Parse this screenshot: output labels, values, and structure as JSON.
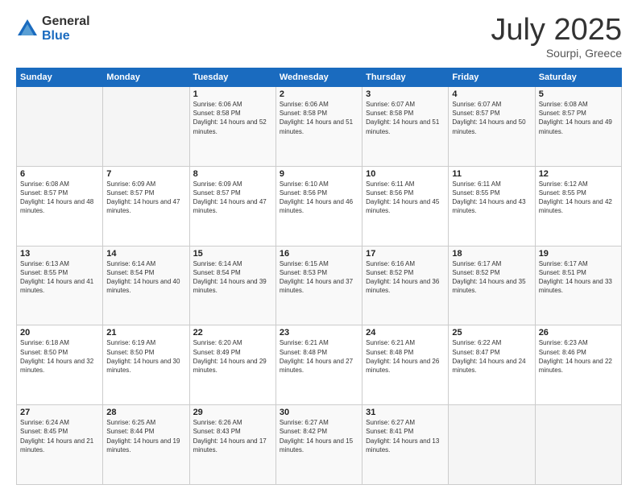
{
  "header": {
    "logo_general": "General",
    "logo_blue": "Blue",
    "month_title": "July 2025",
    "location": "Sourpi, Greece"
  },
  "weekdays": [
    "Sunday",
    "Monday",
    "Tuesday",
    "Wednesday",
    "Thursday",
    "Friday",
    "Saturday"
  ],
  "weeks": [
    [
      {
        "day": "",
        "sunrise": "",
        "sunset": "",
        "daylight": ""
      },
      {
        "day": "",
        "sunrise": "",
        "sunset": "",
        "daylight": ""
      },
      {
        "day": "1",
        "sunrise": "Sunrise: 6:06 AM",
        "sunset": "Sunset: 8:58 PM",
        "daylight": "Daylight: 14 hours and 52 minutes."
      },
      {
        "day": "2",
        "sunrise": "Sunrise: 6:06 AM",
        "sunset": "Sunset: 8:58 PM",
        "daylight": "Daylight: 14 hours and 51 minutes."
      },
      {
        "day": "3",
        "sunrise": "Sunrise: 6:07 AM",
        "sunset": "Sunset: 8:58 PM",
        "daylight": "Daylight: 14 hours and 51 minutes."
      },
      {
        "day": "4",
        "sunrise": "Sunrise: 6:07 AM",
        "sunset": "Sunset: 8:57 PM",
        "daylight": "Daylight: 14 hours and 50 minutes."
      },
      {
        "day": "5",
        "sunrise": "Sunrise: 6:08 AM",
        "sunset": "Sunset: 8:57 PM",
        "daylight": "Daylight: 14 hours and 49 minutes."
      }
    ],
    [
      {
        "day": "6",
        "sunrise": "Sunrise: 6:08 AM",
        "sunset": "Sunset: 8:57 PM",
        "daylight": "Daylight: 14 hours and 48 minutes."
      },
      {
        "day": "7",
        "sunrise": "Sunrise: 6:09 AM",
        "sunset": "Sunset: 8:57 PM",
        "daylight": "Daylight: 14 hours and 47 minutes."
      },
      {
        "day": "8",
        "sunrise": "Sunrise: 6:09 AM",
        "sunset": "Sunset: 8:57 PM",
        "daylight": "Daylight: 14 hours and 47 minutes."
      },
      {
        "day": "9",
        "sunrise": "Sunrise: 6:10 AM",
        "sunset": "Sunset: 8:56 PM",
        "daylight": "Daylight: 14 hours and 46 minutes."
      },
      {
        "day": "10",
        "sunrise": "Sunrise: 6:11 AM",
        "sunset": "Sunset: 8:56 PM",
        "daylight": "Daylight: 14 hours and 45 minutes."
      },
      {
        "day": "11",
        "sunrise": "Sunrise: 6:11 AM",
        "sunset": "Sunset: 8:55 PM",
        "daylight": "Daylight: 14 hours and 43 minutes."
      },
      {
        "day": "12",
        "sunrise": "Sunrise: 6:12 AM",
        "sunset": "Sunset: 8:55 PM",
        "daylight": "Daylight: 14 hours and 42 minutes."
      }
    ],
    [
      {
        "day": "13",
        "sunrise": "Sunrise: 6:13 AM",
        "sunset": "Sunset: 8:55 PM",
        "daylight": "Daylight: 14 hours and 41 minutes."
      },
      {
        "day": "14",
        "sunrise": "Sunrise: 6:14 AM",
        "sunset": "Sunset: 8:54 PM",
        "daylight": "Daylight: 14 hours and 40 minutes."
      },
      {
        "day": "15",
        "sunrise": "Sunrise: 6:14 AM",
        "sunset": "Sunset: 8:54 PM",
        "daylight": "Daylight: 14 hours and 39 minutes."
      },
      {
        "day": "16",
        "sunrise": "Sunrise: 6:15 AM",
        "sunset": "Sunset: 8:53 PM",
        "daylight": "Daylight: 14 hours and 37 minutes."
      },
      {
        "day": "17",
        "sunrise": "Sunrise: 6:16 AM",
        "sunset": "Sunset: 8:52 PM",
        "daylight": "Daylight: 14 hours and 36 minutes."
      },
      {
        "day": "18",
        "sunrise": "Sunrise: 6:17 AM",
        "sunset": "Sunset: 8:52 PM",
        "daylight": "Daylight: 14 hours and 35 minutes."
      },
      {
        "day": "19",
        "sunrise": "Sunrise: 6:17 AM",
        "sunset": "Sunset: 8:51 PM",
        "daylight": "Daylight: 14 hours and 33 minutes."
      }
    ],
    [
      {
        "day": "20",
        "sunrise": "Sunrise: 6:18 AM",
        "sunset": "Sunset: 8:50 PM",
        "daylight": "Daylight: 14 hours and 32 minutes."
      },
      {
        "day": "21",
        "sunrise": "Sunrise: 6:19 AM",
        "sunset": "Sunset: 8:50 PM",
        "daylight": "Daylight: 14 hours and 30 minutes."
      },
      {
        "day": "22",
        "sunrise": "Sunrise: 6:20 AM",
        "sunset": "Sunset: 8:49 PM",
        "daylight": "Daylight: 14 hours and 29 minutes."
      },
      {
        "day": "23",
        "sunrise": "Sunrise: 6:21 AM",
        "sunset": "Sunset: 8:48 PM",
        "daylight": "Daylight: 14 hours and 27 minutes."
      },
      {
        "day": "24",
        "sunrise": "Sunrise: 6:21 AM",
        "sunset": "Sunset: 8:48 PM",
        "daylight": "Daylight: 14 hours and 26 minutes."
      },
      {
        "day": "25",
        "sunrise": "Sunrise: 6:22 AM",
        "sunset": "Sunset: 8:47 PM",
        "daylight": "Daylight: 14 hours and 24 minutes."
      },
      {
        "day": "26",
        "sunrise": "Sunrise: 6:23 AM",
        "sunset": "Sunset: 8:46 PM",
        "daylight": "Daylight: 14 hours and 22 minutes."
      }
    ],
    [
      {
        "day": "27",
        "sunrise": "Sunrise: 6:24 AM",
        "sunset": "Sunset: 8:45 PM",
        "daylight": "Daylight: 14 hours and 21 minutes."
      },
      {
        "day": "28",
        "sunrise": "Sunrise: 6:25 AM",
        "sunset": "Sunset: 8:44 PM",
        "daylight": "Daylight: 14 hours and 19 minutes."
      },
      {
        "day": "29",
        "sunrise": "Sunrise: 6:26 AM",
        "sunset": "Sunset: 8:43 PM",
        "daylight": "Daylight: 14 hours and 17 minutes."
      },
      {
        "day": "30",
        "sunrise": "Sunrise: 6:27 AM",
        "sunset": "Sunset: 8:42 PM",
        "daylight": "Daylight: 14 hours and 15 minutes."
      },
      {
        "day": "31",
        "sunrise": "Sunrise: 6:27 AM",
        "sunset": "Sunset: 8:41 PM",
        "daylight": "Daylight: 14 hours and 13 minutes."
      },
      {
        "day": "",
        "sunrise": "",
        "sunset": "",
        "daylight": ""
      },
      {
        "day": "",
        "sunrise": "",
        "sunset": "",
        "daylight": ""
      }
    ]
  ]
}
